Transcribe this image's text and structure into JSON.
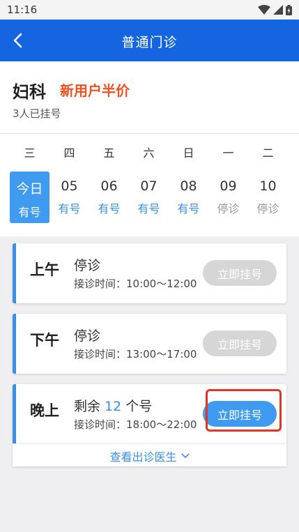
{
  "status_bar": {
    "time": "11:16"
  },
  "app_bar": {
    "title": "普通门诊"
  },
  "header": {
    "department": "妇科",
    "promo": "新用户半价",
    "registered_count": "3人已挂号"
  },
  "calendar": {
    "days": [
      {
        "weekday": "三",
        "date": "今日",
        "status": "有号",
        "selected": true
      },
      {
        "weekday": "四",
        "date": "05",
        "status": "有号"
      },
      {
        "weekday": "五",
        "date": "06",
        "status": "有号"
      },
      {
        "weekday": "六",
        "date": "07",
        "status": "有号"
      },
      {
        "weekday": "日",
        "date": "08",
        "status": "有号"
      },
      {
        "weekday": "一",
        "date": "09",
        "status": "停诊"
      },
      {
        "weekday": "二",
        "date": "10",
        "status": "停诊"
      }
    ]
  },
  "slots": [
    {
      "period": "上午",
      "status": "停诊",
      "time": "接诊时间：10:00～12:00",
      "button": "立即挂号",
      "available": false
    },
    {
      "period": "下午",
      "status": "停诊",
      "time": "接诊时间：13:00～17:00",
      "button": "立即挂号",
      "available": false
    },
    {
      "period": "晚上",
      "status_prefix": "剩余 ",
      "remaining": "12",
      "status_suffix": " 个号",
      "time": "接诊时间：18:00～22:00",
      "button": "立即挂号",
      "available": true
    }
  ],
  "more": {
    "label": "查看出诊医生"
  },
  "colors": {
    "primary": "#1565e0",
    "accent": "#3a8fe6",
    "promo": "#f0511f",
    "highlight": "#e03524"
  }
}
